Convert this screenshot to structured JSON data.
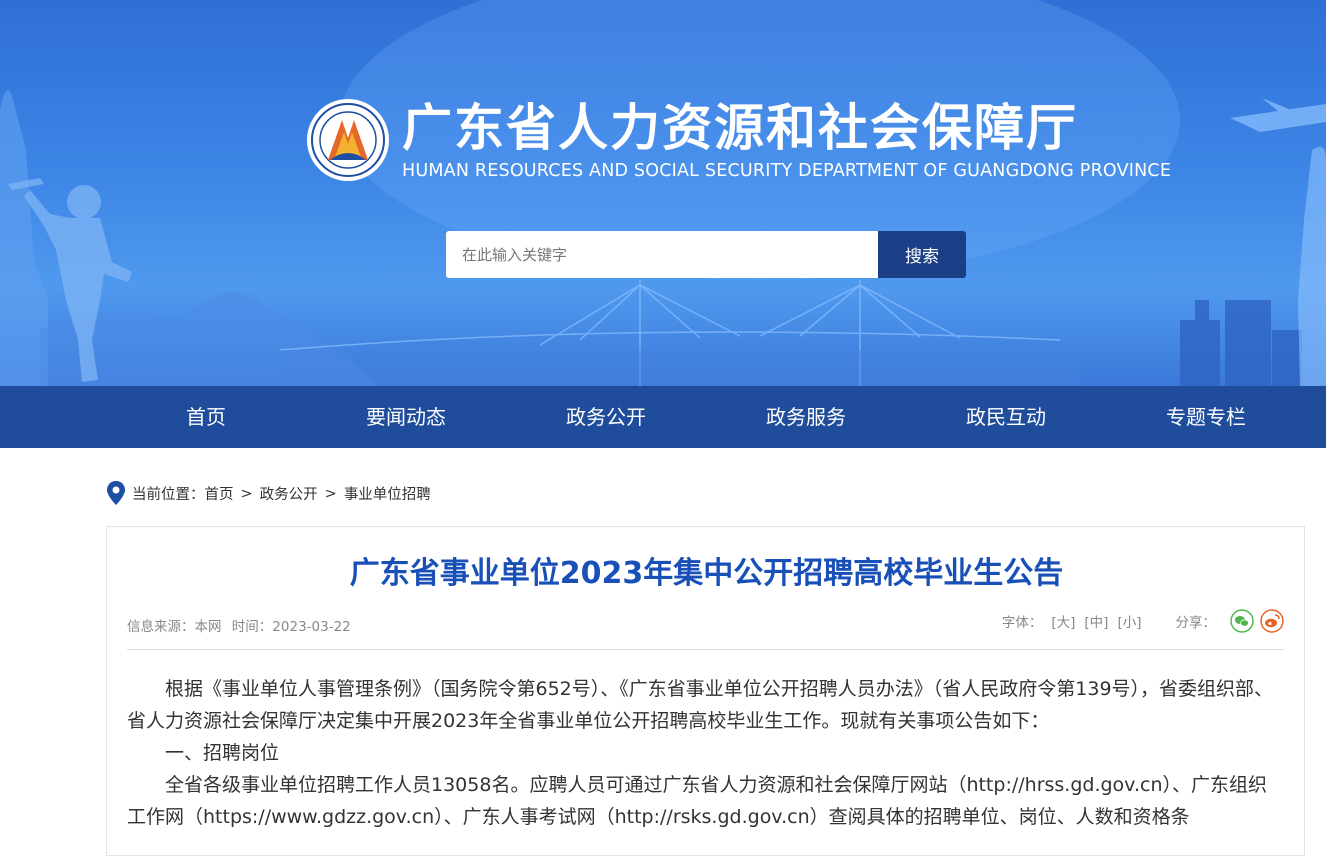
{
  "header": {
    "title_zh": "广东省人力资源和社会保障厅",
    "title_en": "HUMAN RESOURCES AND SOCIAL SECURITY DEPARTMENT OF GUANGDONG PROVINCE",
    "colors": {
      "banner_top": "#2f6fd6",
      "banner_bottom": "#4f99ee",
      "nav_bg": "#1f4d9c",
      "search_btn": "#1b3f87"
    }
  },
  "search": {
    "placeholder": "在此输入关键字",
    "button_label": "搜索"
  },
  "nav": {
    "items": [
      {
        "label": "首页"
      },
      {
        "label": "要闻动态"
      },
      {
        "label": "政务公开"
      },
      {
        "label": "政务服务"
      },
      {
        "label": "政民互动"
      },
      {
        "label": "专题专栏"
      }
    ]
  },
  "breadcrumb": {
    "prefix": "当前位置：",
    "items": [
      "首页",
      "政务公开",
      "事业单位招聘"
    ],
    "separator": ">"
  },
  "article": {
    "title": "广东省事业单位2023年集中公开招聘高校毕业生公告",
    "source_label": "信息来源：本网",
    "time_label": "时间：2023-03-22",
    "font_label": "字体：",
    "font_sizes": [
      "[大]",
      "[中]",
      "[小]"
    ],
    "share_label": "分享：",
    "title_color": "#1850b8",
    "paragraphs": [
      "根据《事业单位人事管理条例》（国务院令第652号）、《广东省事业单位公开招聘人员办法》（省人民政府令第139号），省委组织部、省人力资源社会保障厅决定集中开展2023年全省事业单位公开招聘高校毕业生工作。现就有关事项公告如下：",
      "一、招聘岗位",
      "全省各级事业单位招聘工作人员13058名。应聘人员可通过广东省人力资源和社会保障厅网站（http://hrss.gd.gov.cn）、广东组织工作网（https://www.gdzz.gov.cn）、广东人事考试网（http://rsks.gd.gov.cn）查阅具体的招聘单位、岗位、人数和资格条"
    ]
  }
}
